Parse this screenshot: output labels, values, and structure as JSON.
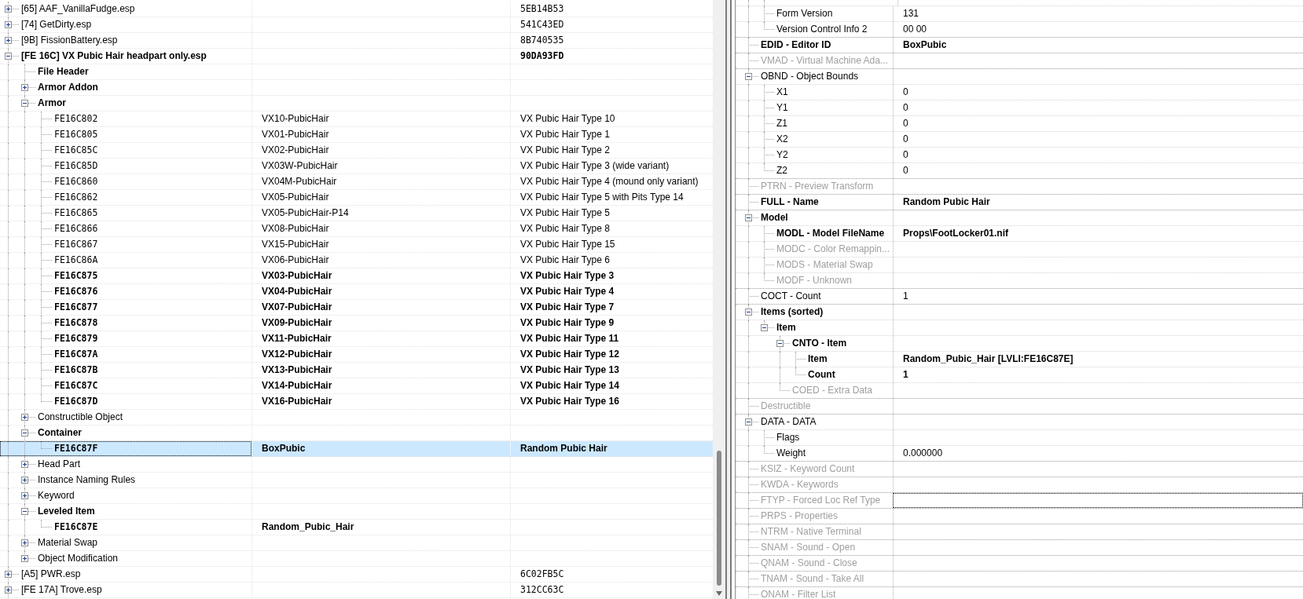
{
  "plugin_tree": {
    "rows": [
      {
        "kind": "plugin",
        "text": "[65] AAF_VanillaFudge.esp",
        "column_3": "5EB14B53",
        "bold": false,
        "selected": false,
        "expanded": false
      },
      {
        "kind": "plugin",
        "text": "[74] GetDirty.esp",
        "column_3": "541C43ED",
        "bold": false,
        "selected": false,
        "expanded": false
      },
      {
        "kind": "plugin",
        "text": "[9B] FissionBattery.esp",
        "column_3": "8B740535",
        "bold": false,
        "selected": false,
        "expanded": false
      },
      {
        "kind": "plugin",
        "text": "[FE 16C] VX Pubic Hair headpart only.esp",
        "column_3": "90DA93FD",
        "bold": true,
        "selected": false,
        "expanded": true,
        "children": [
          {
            "kind": "group",
            "text": "File Header",
            "bold": true,
            "selected": false
          },
          {
            "kind": "group",
            "text": "Armor Addon",
            "bold": true,
            "selected": false,
            "expanded": false
          },
          {
            "kind": "group",
            "text": "Armor",
            "bold": true,
            "selected": false,
            "expanded": true,
            "children": [
              {
                "kind": "record",
                "text": "FE16C802",
                "column_2": "VX10-PubicHair",
                "column_3": "VX Pubic Hair Type 10",
                "bold": false,
                "selected": false
              },
              {
                "kind": "record",
                "text": "FE16C805",
                "column_2": "VX01-PubicHair",
                "column_3": "VX Pubic Hair Type 1",
                "bold": false,
                "selected": false
              },
              {
                "kind": "record",
                "text": "FE16C85C",
                "column_2": "VX02-PubicHair",
                "column_3": "VX Pubic Hair Type 2",
                "bold": false,
                "selected": false
              },
              {
                "kind": "record",
                "text": "FE16C85D",
                "column_2": "VX03W-PubicHair",
                "column_3": "VX Pubic Hair Type 3 (wide variant)",
                "bold": false,
                "selected": false
              },
              {
                "kind": "record",
                "text": "FE16C860",
                "column_2": "VX04M-PubicHair",
                "column_3": "VX Pubic Hair Type 4 (mound only variant)",
                "bold": false,
                "selected": false
              },
              {
                "kind": "record",
                "text": "FE16C862",
                "column_2": "VX05-PubicHair",
                "column_3": "VX Pubic Hair Type 5 with Pits Type 14",
                "bold": false,
                "selected": false
              },
              {
                "kind": "record",
                "text": "FE16C865",
                "column_2": "VX05-PubicHair-P14",
                "column_3": "VX Pubic Hair Type 5",
                "bold": false,
                "selected": false
              },
              {
                "kind": "record",
                "text": "FE16C866",
                "column_2": "VX08-PubicHair",
                "column_3": "VX Pubic Hair Type 8",
                "bold": false,
                "selected": false
              },
              {
                "kind": "record",
                "text": "FE16C867",
                "column_2": "VX15-PubicHair",
                "column_3": "VX Pubic Hair Type 15",
                "bold": false,
                "selected": false
              },
              {
                "kind": "record",
                "text": "FE16C86A",
                "column_2": "VX06-PubicHair",
                "column_3": "VX Pubic Hair Type 6",
                "bold": false,
                "selected": false
              },
              {
                "kind": "record",
                "text": "FE16C875",
                "column_2": "VX03-PubicHair",
                "column_3": "VX Pubic Hair Type 3",
                "bold": true,
                "selected": false
              },
              {
                "kind": "record",
                "text": "FE16C876",
                "column_2": "VX04-PubicHair",
                "column_3": "VX Pubic Hair Type 4",
                "bold": true,
                "selected": false
              },
              {
                "kind": "record",
                "text": "FE16C877",
                "column_2": "VX07-PubicHair",
                "column_3": "VX Pubic Hair Type 7",
                "bold": true,
                "selected": false
              },
              {
                "kind": "record",
                "text": "FE16C878",
                "column_2": "VX09-PubicHair",
                "column_3": "VX Pubic Hair Type 9",
                "bold": true,
                "selected": false
              },
              {
                "kind": "record",
                "text": "FE16C879",
                "column_2": "VX11-PubicHair",
                "column_3": "VX Pubic Hair Type 11",
                "bold": true,
                "selected": false
              },
              {
                "kind": "record",
                "text": "FE16C87A",
                "column_2": "VX12-PubicHair",
                "column_3": "VX Pubic Hair Type 12",
                "bold": true,
                "selected": false
              },
              {
                "kind": "record",
                "text": "FE16C87B",
                "column_2": "VX13-PubicHair",
                "column_3": "VX Pubic Hair Type 13",
                "bold": true,
                "selected": false
              },
              {
                "kind": "record",
                "text": "FE16C87C",
                "column_2": "VX14-PubicHair",
                "column_3": "VX Pubic Hair Type 14",
                "bold": true,
                "selected": false
              },
              {
                "kind": "record",
                "text": "FE16C87D",
                "column_2": "VX16-PubicHair",
                "column_3": "VX Pubic Hair Type 16",
                "bold": true,
                "selected": false
              }
            ]
          },
          {
            "kind": "group",
            "text": "Constructible Object",
            "bold": false,
            "selected": false,
            "expanded": false
          },
          {
            "kind": "group",
            "text": "Container",
            "bold": true,
            "selected": false,
            "expanded": true,
            "children": [
              {
                "kind": "record",
                "text": "FE16C87F",
                "column_2": "BoxPubic",
                "column_3": "Random Pubic Hair",
                "bold": true,
                "selected": true
              }
            ]
          },
          {
            "kind": "group",
            "text": "Head Part",
            "bold": false,
            "selected": false,
            "expanded": false
          },
          {
            "kind": "group",
            "text": "Instance Naming Rules",
            "bold": false,
            "selected": false,
            "expanded": false
          },
          {
            "kind": "group",
            "text": "Keyword",
            "bold": false,
            "selected": false,
            "expanded": false
          },
          {
            "kind": "group",
            "text": "Leveled Item",
            "bold": true,
            "selected": false,
            "expanded": true,
            "children": [
              {
                "kind": "record",
                "text": "FE16C87E",
                "column_2": "Random_Pubic_Hair",
                "bold": true,
                "selected": false
              }
            ]
          },
          {
            "kind": "group",
            "text": "Material Swap",
            "bold": false,
            "selected": false,
            "expanded": false
          },
          {
            "kind": "group",
            "text": "Object Modification",
            "bold": false,
            "selected": false,
            "expanded": false
          }
        ]
      },
      {
        "kind": "plugin",
        "text": "[A5] PWR.esp",
        "column_3": "6C02FB5C",
        "bold": false,
        "selected": false,
        "expanded": false
      },
      {
        "kind": "plugin",
        "text": "[FE 17A] Trove.esp",
        "column_3": "312CC63C",
        "bold": false,
        "selected": false,
        "expanded": false
      }
    ]
  },
  "record_view": {
    "rows": [
      {
        "children": [
          {
            "label": "Form Version",
            "value": "131",
            "bold": false,
            "disabled": false,
            "focused": false
          },
          {
            "label": "Version Control Info 2",
            "value": "00 00",
            "bold": false,
            "disabled": false,
            "focused": false
          }
        ]
      },
      {
        "label": "EDID - Editor ID",
        "value": "BoxPubic",
        "bold": true,
        "disabled": false,
        "focused": false
      },
      {
        "label": "VMAD - Virtual Machine Ada...",
        "bold": false,
        "disabled": true,
        "focused": false
      },
      {
        "label": "OBND - Object Bounds",
        "bold": false,
        "disabled": false,
        "focused": false,
        "expanded": true,
        "children": [
          {
            "label": "X1",
            "value": "0",
            "bold": false,
            "disabled": false,
            "focused": false
          },
          {
            "label": "Y1",
            "value": "0",
            "bold": false,
            "disabled": false,
            "focused": false
          },
          {
            "label": "Z1",
            "value": "0",
            "bold": false,
            "disabled": false,
            "focused": false
          },
          {
            "label": "X2",
            "value": "0",
            "bold": false,
            "disabled": false,
            "focused": false
          },
          {
            "label": "Y2",
            "value": "0",
            "bold": false,
            "disabled": false,
            "focused": false
          },
          {
            "label": "Z2",
            "value": "0",
            "bold": false,
            "disabled": false,
            "focused": false
          }
        ]
      },
      {
        "label": "PTRN - Preview Transform",
        "bold": false,
        "disabled": true,
        "focused": false
      },
      {
        "label": "FULL - Name",
        "value": "Random Pubic Hair",
        "bold": true,
        "disabled": false,
        "focused": false
      },
      {
        "label": "Model",
        "bold": true,
        "disabled": false,
        "focused": false,
        "expanded": true,
        "children": [
          {
            "label": "MODL - Model FileName",
            "value": "Props\\FootLocker01.nif",
            "bold": true,
            "disabled": false,
            "focused": false
          },
          {
            "label": "MODC - Color Remappin...",
            "bold": false,
            "disabled": true,
            "focused": false
          },
          {
            "label": "MODS - Material Swap",
            "bold": false,
            "disabled": true,
            "focused": false
          },
          {
            "label": "MODF - Unknown",
            "bold": false,
            "disabled": true,
            "focused": false
          }
        ]
      },
      {
        "label": "COCT - Count",
        "value": "1",
        "bold": false,
        "disabled": false,
        "focused": false
      },
      {
        "label": "Items (sorted)",
        "bold": true,
        "disabled": false,
        "focused": false,
        "expanded": true,
        "children": [
          {
            "label": "Item",
            "bold": true,
            "disabled": false,
            "focused": false,
            "expanded": true,
            "children": [
              {
                "label": "CNTO - Item",
                "bold": true,
                "disabled": false,
                "focused": false,
                "expanded": true,
                "children": [
                  {
                    "label": "Item",
                    "value": "Random_Pubic_Hair [LVLI:FE16C87E]",
                    "bold": true,
                    "disabled": false,
                    "focused": false
                  },
                  {
                    "label": "Count",
                    "value": "1",
                    "bold": true,
                    "disabled": false,
                    "focused": false
                  }
                ]
              },
              {
                "label": "COED - Extra Data",
                "bold": false,
                "disabled": true,
                "focused": false
              }
            ]
          }
        ]
      },
      {
        "label": "Destructible",
        "bold": false,
        "disabled": true,
        "focused": false
      },
      {
        "label": "DATA - DATA",
        "bold": false,
        "disabled": false,
        "focused": false,
        "expanded": true,
        "children": [
          {
            "label": "Flags",
            "bold": false,
            "disabled": false,
            "focused": false
          },
          {
            "label": "Weight",
            "value": "0.000000",
            "bold": false,
            "disabled": false,
            "focused": false
          }
        ]
      },
      {
        "label": "KSIZ - Keyword Count",
        "bold": false,
        "disabled": true,
        "focused": false
      },
      {
        "label": "KWDA - Keywords",
        "bold": false,
        "disabled": true,
        "focused": false
      },
      {
        "label": "FTYP - Forced Loc Ref Type",
        "bold": false,
        "disabled": true,
        "focused": true
      },
      {
        "label": "PRPS - Properties",
        "bold": false,
        "disabled": true,
        "focused": false
      },
      {
        "label": "NTRM - Native Terminal",
        "bold": false,
        "disabled": true,
        "focused": false
      },
      {
        "label": "SNAM - Sound - Open",
        "bold": false,
        "disabled": true,
        "focused": false
      },
      {
        "label": "QNAM - Sound - Close",
        "bold": false,
        "disabled": true,
        "focused": false
      },
      {
        "label": "TNAM - Sound - Take All",
        "bold": false,
        "disabled": true,
        "focused": false
      },
      {
        "label": "ONAM - Filter List",
        "bold": false,
        "disabled": true,
        "focused": false
      }
    ]
  }
}
